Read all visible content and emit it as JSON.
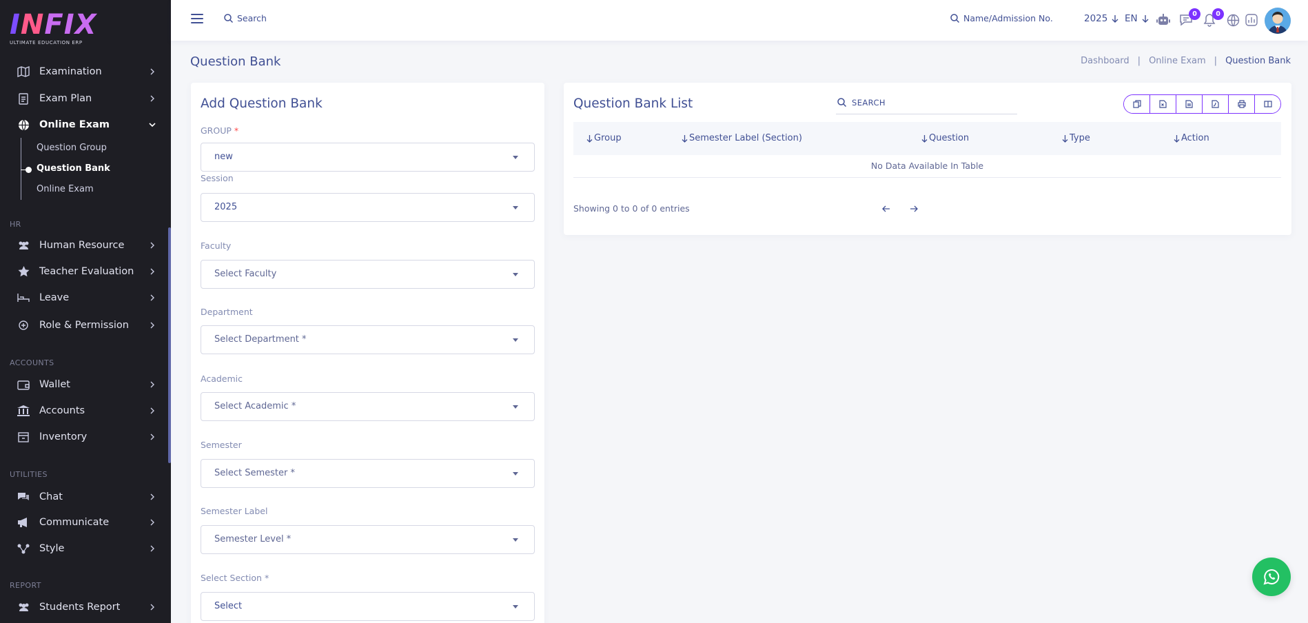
{
  "brand": {
    "name_part1": "I",
    "name_part2": "N",
    "name_part3": "FIX",
    "subtitle": "ULTIMATE EDUCATION ERP"
  },
  "sidebar": {
    "items_top": [
      {
        "label": "Examination",
        "icon": "map-icon"
      },
      {
        "label": "Exam Plan",
        "icon": "clipboard-icon"
      },
      {
        "label": "Online Exam",
        "icon": "globe-icon"
      }
    ],
    "online_exam_sub": [
      {
        "label": "Question Group"
      },
      {
        "label": "Question Bank"
      },
      {
        "label": "Online Exam"
      }
    ],
    "section_hr": "HR",
    "items_hr": [
      {
        "label": "Human Resource",
        "icon": "users-icon"
      },
      {
        "label": "Teacher Evaluation",
        "icon": "star-icon"
      },
      {
        "label": "Leave",
        "icon": "bed-icon"
      },
      {
        "label": "Role & Permission",
        "icon": "key-icon"
      }
    ],
    "section_accounts": "ACCOUNTS",
    "items_accounts": [
      {
        "label": "Wallet",
        "icon": "wallet-icon"
      },
      {
        "label": "Accounts",
        "icon": "bank-icon"
      },
      {
        "label": "Inventory",
        "icon": "inventory-icon"
      }
    ],
    "section_utilities": "UTILITIES",
    "items_utilities": [
      {
        "label": "Chat",
        "icon": "chat-icon"
      },
      {
        "label": "Communicate",
        "icon": "megaphone-icon"
      },
      {
        "label": "Style",
        "icon": "style-icon"
      }
    ],
    "section_report": "REPORT",
    "items_report": [
      {
        "label": "Students Report",
        "icon": "users-icon"
      }
    ]
  },
  "topbar": {
    "search_placeholder": "Search",
    "admission_placeholder": "Name/Admission No.",
    "year": "2025",
    "language": "EN",
    "messages_count": "0",
    "notifications_count": "0"
  },
  "page": {
    "title": "Question Bank",
    "breadcrumb": [
      "Dashboard",
      "Online Exam",
      "Question Bank"
    ]
  },
  "form": {
    "title": "Add Question Bank",
    "fields": [
      {
        "label": "GROUP",
        "required_mark": "*",
        "value": "new"
      },
      {
        "label": "Session",
        "value": "2025"
      },
      {
        "label": "Faculty",
        "value": "Select Faculty"
      },
      {
        "label": "Department",
        "value": "Select Department *"
      },
      {
        "label": "Academic",
        "value": "Select Academic *"
      },
      {
        "label": "Semester",
        "value": "Select Semester *"
      },
      {
        "label": "Semester Label",
        "value": "Semester Level *"
      },
      {
        "label": "Select Section *",
        "value": "Select"
      }
    ]
  },
  "list": {
    "title": "Question Bank List",
    "search_placeholder": "SEARCH",
    "columns": [
      "Group",
      "Semester Label (Section)",
      "Question",
      "Type",
      "Action"
    ],
    "empty_text": "No Data Available In Table",
    "showing": "Showing 0 to 0 of 0 entries"
  },
  "colors": {
    "primary": "#415094",
    "accent": "#7c32ff",
    "sidebar_bg": "#1e1e24",
    "whatsapp": "#23c063"
  }
}
